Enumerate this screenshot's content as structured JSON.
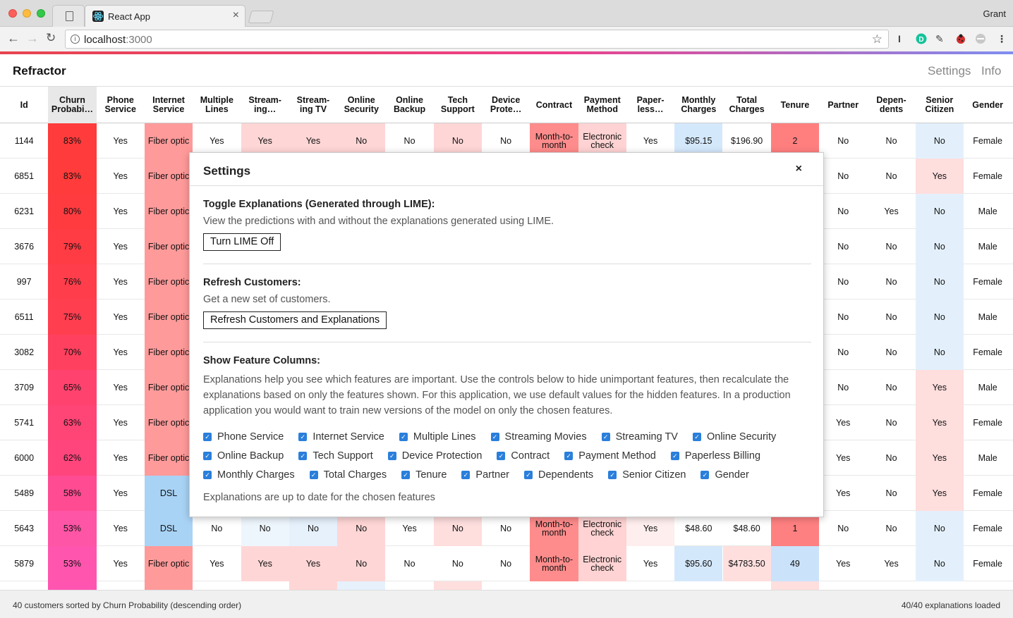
{
  "browser": {
    "tab_title": "React App",
    "profile": "Grant",
    "url_host": "localhost",
    "url_port": ":3000"
  },
  "app": {
    "brand": "Refractor",
    "nav": [
      "Settings",
      "Info"
    ]
  },
  "table": {
    "columns": [
      "Id",
      "Churn Probabi…",
      "Phone Service",
      "Internet Service",
      "Multiple Lines",
      "Stream-ing…",
      "Stream-ing TV",
      "Online Security",
      "Online Backup",
      "Tech Support",
      "Device Prote…",
      "Contract",
      "Payment Method",
      "Paper-less…",
      "Monthly Charges",
      "Total Charges",
      "Tenure",
      "Partner",
      "Depen-dents",
      "Senior Citizen",
      "Gender"
    ],
    "rows": [
      {
        "cells": [
          "1144",
          "83%",
          "Yes",
          "Fiber optic",
          "Yes",
          "Yes",
          "Yes",
          "No",
          "No",
          "No",
          "No",
          "Month-to-month",
          "Electronic check",
          "Yes",
          "$95.15",
          "$196.90",
          "2",
          "No",
          "No",
          "No",
          "Female"
        ],
        "colors": [
          "",
          "#ff3b3b",
          "",
          "#ff9a9a",
          "",
          "#ffd6d6",
          "#ffd6d6",
          "#ffd6d6",
          "",
          "#ffd6d6",
          "",
          "#ff8c8c",
          "#ffd3d3",
          "",
          "#d4e8fb",
          "",
          "#ff7f7f",
          "",
          "",
          "#e3f0fc",
          ""
        ]
      },
      {
        "cells": [
          "6851",
          "83%",
          "Yes",
          "Fiber optic",
          "",
          "",
          "",
          "",
          "",
          "",
          "",
          "",
          "",
          "",
          "",
          "",
          "",
          "No",
          "No",
          "Yes",
          "Female"
        ],
        "colors": [
          "",
          "#ff3b3b",
          "",
          "#ff9a9a",
          "",
          "",
          "",
          "",
          "",
          "",
          "",
          "",
          "",
          "",
          "",
          "",
          "",
          "",
          "",
          "#ffdede",
          ""
        ]
      },
      {
        "cells": [
          "6231",
          "80%",
          "Yes",
          "Fiber optic",
          "",
          "",
          "",
          "",
          "",
          "",
          "",
          "",
          "",
          "",
          "",
          "",
          "",
          "No",
          "Yes",
          "No",
          "Male"
        ],
        "colors": [
          "",
          "#ff3b40",
          "",
          "#ff9a9a",
          "",
          "",
          "",
          "",
          "",
          "",
          "",
          "",
          "",
          "",
          "",
          "",
          "",
          "",
          "",
          "#e3f0fc",
          ""
        ]
      },
      {
        "cells": [
          "3676",
          "79%",
          "Yes",
          "Fiber optic",
          "",
          "",
          "",
          "",
          "",
          "",
          "",
          "",
          "",
          "",
          "",
          "",
          "",
          "No",
          "No",
          "No",
          "Male"
        ],
        "colors": [
          "",
          "#ff3b44",
          "",
          "#ff9a9a",
          "",
          "",
          "",
          "",
          "",
          "",
          "",
          "",
          "",
          "",
          "",
          "",
          "",
          "",
          "",
          "#e3f0fc",
          ""
        ]
      },
      {
        "cells": [
          "997",
          "76%",
          "Yes",
          "Fiber optic",
          "",
          "",
          "",
          "",
          "",
          "",
          "",
          "",
          "",
          "",
          "",
          "",
          "",
          "No",
          "No",
          "No",
          "Female"
        ],
        "colors": [
          "",
          "#ff3d4b",
          "",
          "#ff9a9a",
          "",
          "",
          "",
          "",
          "",
          "",
          "",
          "",
          "",
          "",
          "",
          "",
          "",
          "",
          "",
          "#e3f0fc",
          ""
        ]
      },
      {
        "cells": [
          "6511",
          "75%",
          "Yes",
          "Fiber optic",
          "",
          "",
          "",
          "",
          "",
          "",
          "",
          "",
          "",
          "",
          "",
          "",
          "",
          "No",
          "No",
          "No",
          "Male"
        ],
        "colors": [
          "",
          "#ff3e50",
          "",
          "#ff9a9a",
          "",
          "",
          "",
          "",
          "",
          "",
          "",
          "",
          "",
          "",
          "",
          "",
          "",
          "",
          "",
          "#e3f0fc",
          ""
        ]
      },
      {
        "cells": [
          "3082",
          "70%",
          "Yes",
          "Fiber optic",
          "",
          "",
          "",
          "",
          "",
          "",
          "",
          "",
          "",
          "",
          "",
          "",
          "",
          "No",
          "No",
          "No",
          "Female"
        ],
        "colors": [
          "",
          "#ff405e",
          "",
          "#ff9a9a",
          "",
          "",
          "",
          "",
          "",
          "",
          "",
          "",
          "",
          "",
          "",
          "",
          "",
          "",
          "",
          "#e3f0fc",
          ""
        ]
      },
      {
        "cells": [
          "3709",
          "65%",
          "Yes",
          "Fiber optic",
          "",
          "",
          "",
          "",
          "",
          "",
          "",
          "",
          "",
          "",
          "",
          "",
          "",
          "No",
          "No",
          "Yes",
          "Male"
        ],
        "colors": [
          "",
          "#ff436e",
          "",
          "#ff9a9a",
          "",
          "",
          "",
          "",
          "",
          "",
          "",
          "",
          "",
          "",
          "",
          "",
          "",
          "",
          "",
          "#ffdede",
          ""
        ]
      },
      {
        "cells": [
          "5741",
          "63%",
          "Yes",
          "Fiber optic",
          "",
          "",
          "",
          "",
          "",
          "",
          "",
          "",
          "",
          "",
          "",
          "",
          "",
          "Yes",
          "No",
          "Yes",
          "Female"
        ],
        "colors": [
          "",
          "#ff4476",
          "",
          "#ff9a9a",
          "",
          "",
          "",
          "",
          "",
          "",
          "",
          "",
          "",
          "",
          "",
          "",
          "",
          "",
          "",
          "#ffdede",
          ""
        ]
      },
      {
        "cells": [
          "6000",
          "62%",
          "Yes",
          "Fiber optic",
          "",
          "",
          "",
          "",
          "",
          "",
          "",
          "",
          "",
          "",
          "",
          "",
          "",
          "Yes",
          "No",
          "Yes",
          "Male"
        ],
        "colors": [
          "",
          "#ff457c",
          "",
          "#ff9a9a",
          "",
          "",
          "",
          "",
          "",
          "",
          "",
          "",
          "",
          "",
          "",
          "",
          "",
          "",
          "",
          "#ffdede",
          ""
        ]
      },
      {
        "cells": [
          "5489",
          "58%",
          "Yes",
          "DSL",
          "",
          "",
          "",
          "",
          "",
          "",
          "",
          "",
          "",
          "",
          "",
          "",
          "",
          "Yes",
          "No",
          "Yes",
          "Female"
        ],
        "colors": [
          "",
          "#ff4b92",
          "",
          "#a9d3f5",
          "",
          "",
          "",
          "",
          "",
          "",
          "",
          "",
          "",
          "",
          "",
          "",
          "",
          "",
          "",
          "#ffdede",
          ""
        ]
      },
      {
        "cells": [
          "5643",
          "53%",
          "Yes",
          "DSL",
          "No",
          "No",
          "No",
          "No",
          "Yes",
          "No",
          "No",
          "Month-to-month",
          "Electronic check",
          "Yes",
          "$48.60",
          "$48.60",
          "1",
          "No",
          "No",
          "No",
          "Female"
        ],
        "colors": [
          "",
          "#ff55a6",
          "",
          "#a9d3f5",
          "",
          "#eef6fd",
          "#e6f1fc",
          "#ffd6d6",
          "",
          "#ffdede",
          "",
          "#ff8c8c",
          "#ffd3d3",
          "#ffeeee",
          "",
          "",
          "#ff8080",
          "",
          "",
          "#e3f0fc",
          ""
        ]
      },
      {
        "cells": [
          "5879",
          "53%",
          "Yes",
          "Fiber optic",
          "Yes",
          "Yes",
          "Yes",
          "No",
          "No",
          "No",
          "No",
          "Month-to-month",
          "Electronic check",
          "Yes",
          "$95.60",
          "$4783.50",
          "49",
          "Yes",
          "Yes",
          "No",
          "Female"
        ],
        "colors": [
          "",
          "#ff55ae",
          "",
          "#ff9a9a",
          "",
          "#ffd6d6",
          "#ffd6d6",
          "#ffd6d6",
          "",
          "",
          "",
          "#ff8c8c",
          "#ffd3d3",
          "",
          "#d4e8fb",
          "#ffdede",
          "#cbe3fa",
          "",
          "",
          "#e3f0fc",
          ""
        ]
      },
      {
        "cells": [
          "",
          "",
          "",
          "",
          "",
          "",
          "",
          "",
          "",
          "",
          "",
          "",
          "",
          "",
          "",
          "",
          "",
          "",
          "",
          "",
          ""
        ],
        "colors": [
          "",
          "#ff55b0",
          "",
          "#ff9a9a",
          "",
          "",
          "#ffd6d6",
          "#e6f1fc",
          "",
          "#ffdede",
          "",
          "",
          "",
          "",
          "",
          "",
          "#ffdede",
          "",
          "",
          "",
          ""
        ]
      }
    ]
  },
  "footer": {
    "left": "40 customers sorted by Churn Probability (descending order)",
    "right": "40/40 explanations loaded"
  },
  "settings_modal": {
    "title": "Settings",
    "close": "×",
    "lime": {
      "title": "Toggle Explanations (Generated through LIME):",
      "text": "View the predictions with and without the explanations generated using LIME.",
      "button": "Turn LIME Off"
    },
    "refresh": {
      "title": "Refresh Customers:",
      "text": "Get a new set of customers.",
      "button": "Refresh Customers and Explanations"
    },
    "features": {
      "title": "Show Feature Columns:",
      "text": "Explanations help you see which features are important. Use the controls below to hide unimportant features, then recalculate the explanations based on only the features shown. For this application, we use default values for the hidden features. In a production application you would want to train new versions of the model on only the chosen features.",
      "rows": [
        [
          "Phone Service",
          "Internet Service",
          "Multiple Lines",
          "Streaming Movies",
          "Streaming TV",
          "Online Security"
        ],
        [
          "Online Backup",
          "Tech Support",
          "Device Protection",
          "Contract",
          "Payment Method",
          "Paperless Billing"
        ],
        [
          "Monthly Charges",
          "Total Charges",
          "Tenure",
          "Partner",
          "Dependents",
          "Senior Citizen",
          "Gender"
        ]
      ],
      "status": "Explanations are up to date for the chosen features"
    }
  }
}
